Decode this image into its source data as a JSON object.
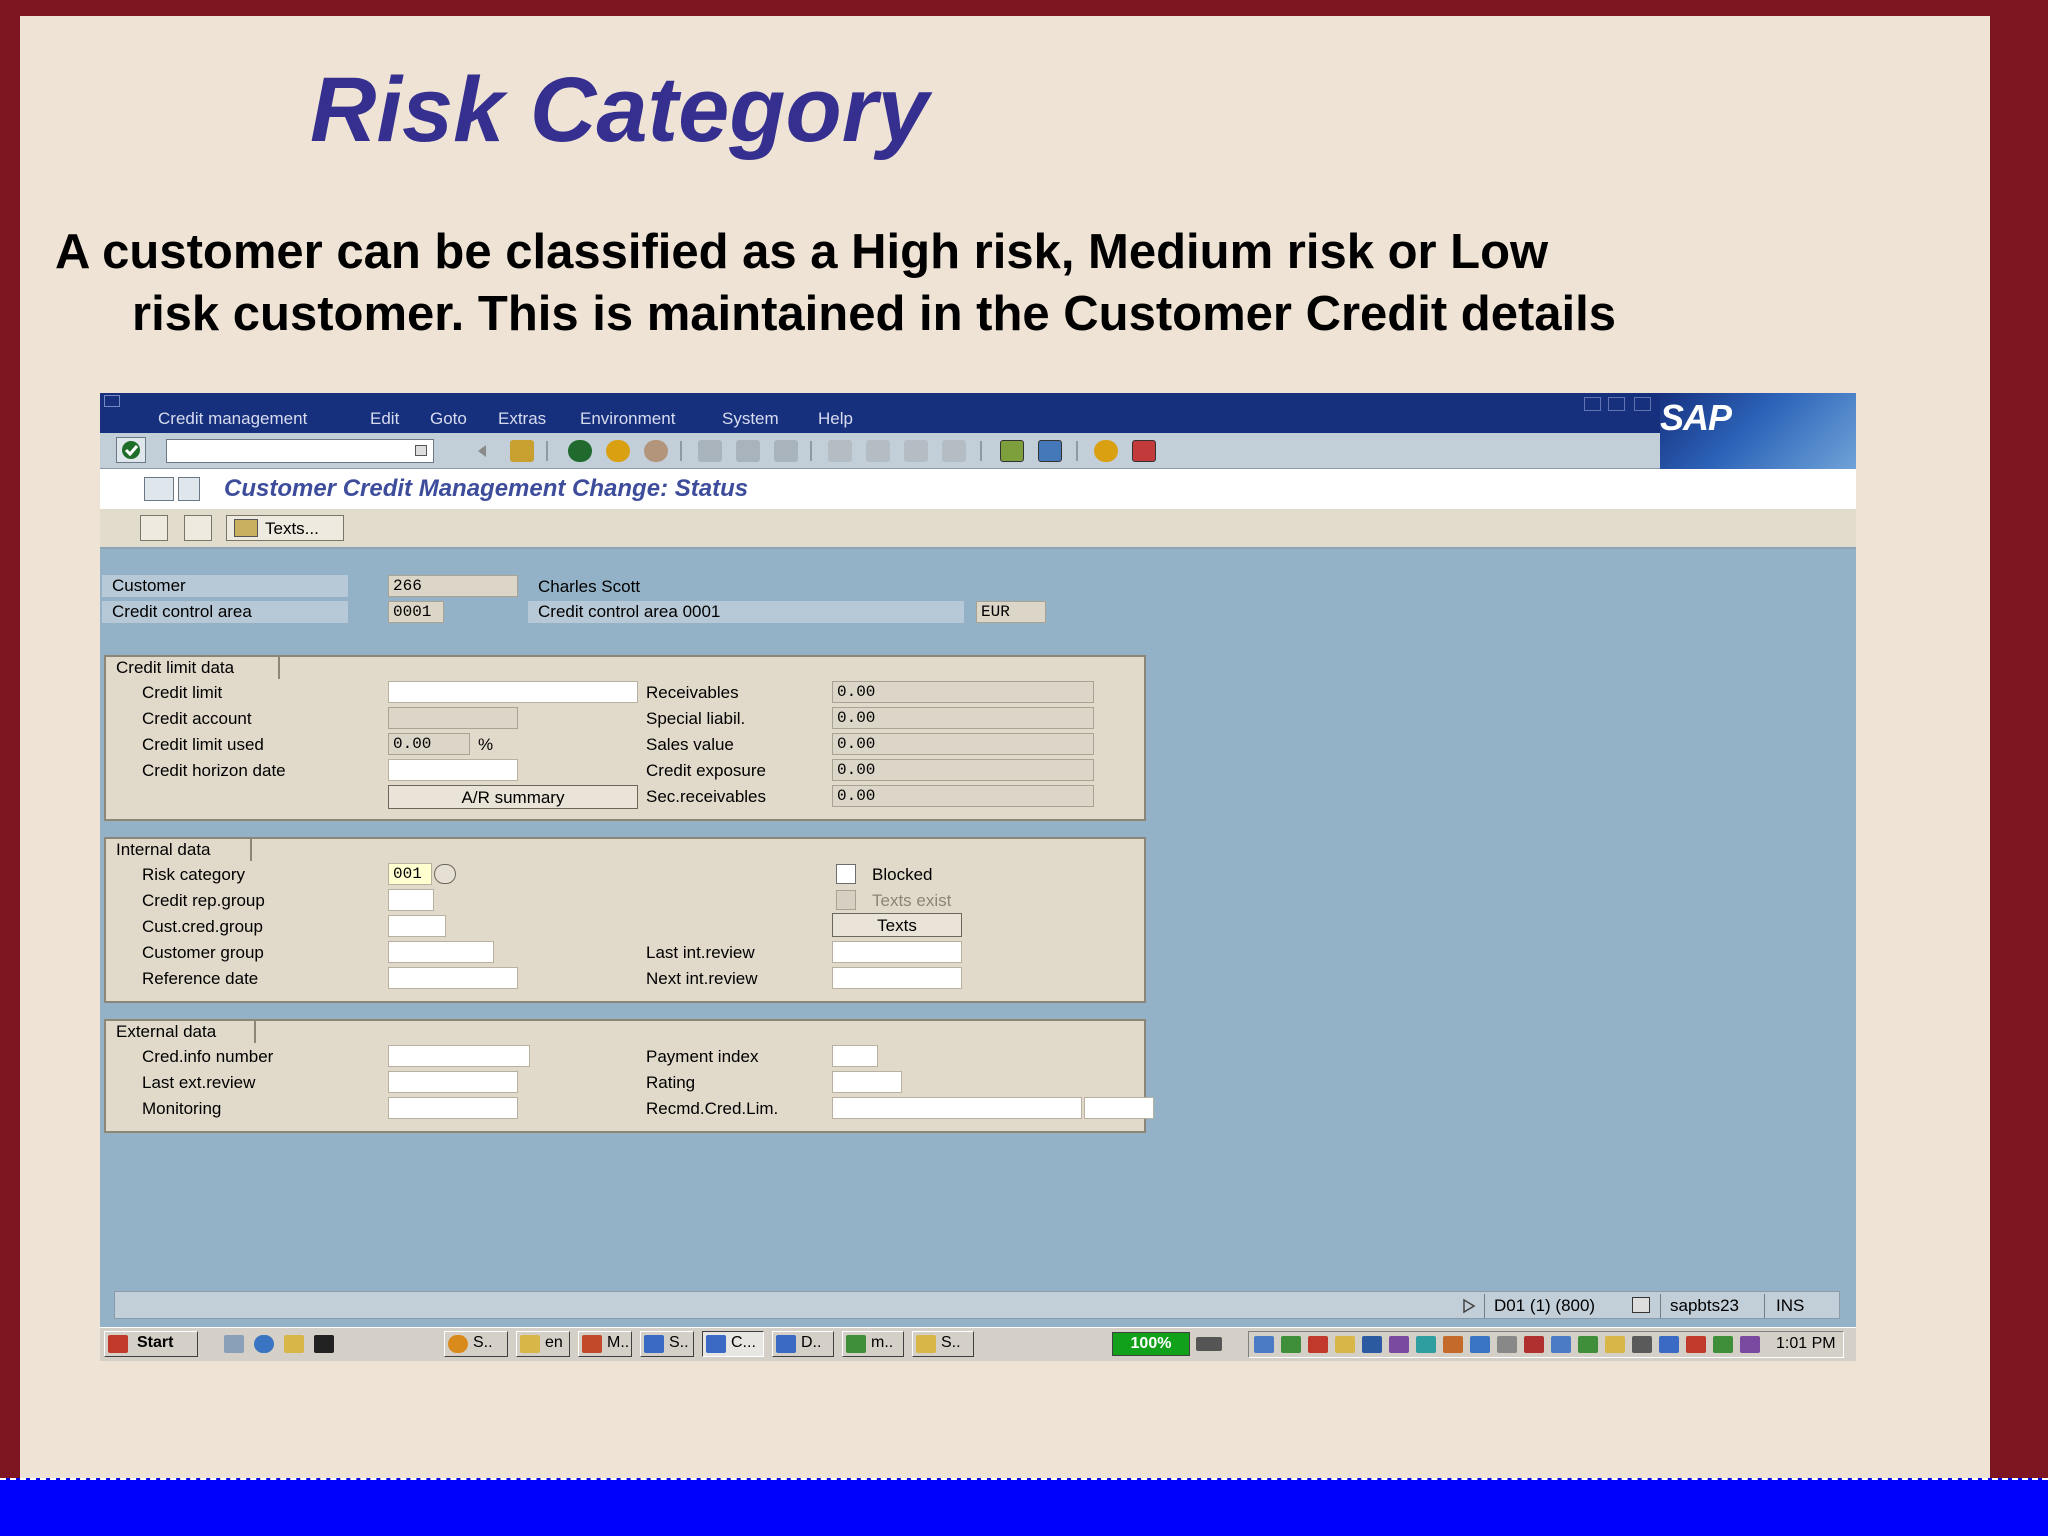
{
  "slide": {
    "title": "Risk Category",
    "body_line1": "A customer can be classified as a High risk, Medium risk or Low",
    "body_line2": "risk customer. This is maintained in the Customer Credit details"
  },
  "sap": {
    "menu": [
      "Credit management",
      "Edit",
      "Goto",
      "Extras",
      "Environment",
      "System",
      "Help"
    ],
    "logo": "SAP",
    "screen_title": "Customer Credit Management Change: Status",
    "app_toolbar": {
      "texts_button": "Texts..."
    },
    "header": {
      "customer_label": "Customer",
      "customer_value": "266",
      "customer_name": "Charles Scott",
      "cca_label": "Credit control area",
      "cca_value": "0001",
      "cca_desc": "Credit control area 0001",
      "currency": "EUR"
    },
    "credit_limit_data": {
      "title": "Credit limit data",
      "credit_limit_label": "Credit limit",
      "credit_limit_value": "",
      "credit_account_label": "Credit account",
      "credit_account_value": "",
      "credit_limit_used_label": "Credit limit used",
      "credit_limit_used_value": "0.00",
      "percent_sign": "%",
      "credit_horizon_label": "Credit horizon date",
      "credit_horizon_value": "",
      "ar_summary_button": "A/R summary",
      "receivables_label": "Receivables",
      "receivables_value": "0.00",
      "special_liabil_label": "Special liabil.",
      "special_liabil_value": "0.00",
      "sales_value_label": "Sales value",
      "sales_value_value": "0.00",
      "credit_exposure_label": "Credit exposure",
      "credit_exposure_value": "0.00",
      "sec_receivables_label": "Sec.receivables",
      "sec_receivables_value": "0.00"
    },
    "internal_data": {
      "title": "Internal data",
      "risk_category_label": "Risk category",
      "risk_category_value": "001",
      "credit_rep_group_label": "Credit rep.group",
      "cust_cred_group_label": "Cust.cred.group",
      "customer_group_label": "Customer group",
      "reference_date_label": "Reference date",
      "blocked_label": "Blocked",
      "blocked_checked": false,
      "texts_exist_label": "Texts exist",
      "texts_button": "Texts",
      "last_int_review_label": "Last int.review",
      "next_int_review_label": "Next int.review"
    },
    "external_data": {
      "title": "External data",
      "cred_info_number_label": "Cred.info number",
      "last_ext_review_label": "Last ext.review",
      "monitoring_label": "Monitoring",
      "payment_index_label": "Payment index",
      "rating_label": "Rating",
      "recmd_cred_lim_label": "Recmd.Cred.Lim."
    },
    "status_bar": {
      "system": "D01 (1) (800)",
      "server": "sapbts23",
      "mode": "INS"
    }
  },
  "taskbar": {
    "start": "Start",
    "tasks": [
      "S..",
      "en",
      "M..",
      "S..",
      "C...",
      "D..",
      "m..",
      "S.."
    ],
    "battery": "100%",
    "clock": "1:01 PM"
  },
  "colors": {
    "frame": "#7d1620",
    "slide_bg": "#efe3d5",
    "title": "#352f8f",
    "sap_menubar": "#17307e",
    "sap_bg": "#93b2c7",
    "bottom_bar": "#0000fd"
  }
}
